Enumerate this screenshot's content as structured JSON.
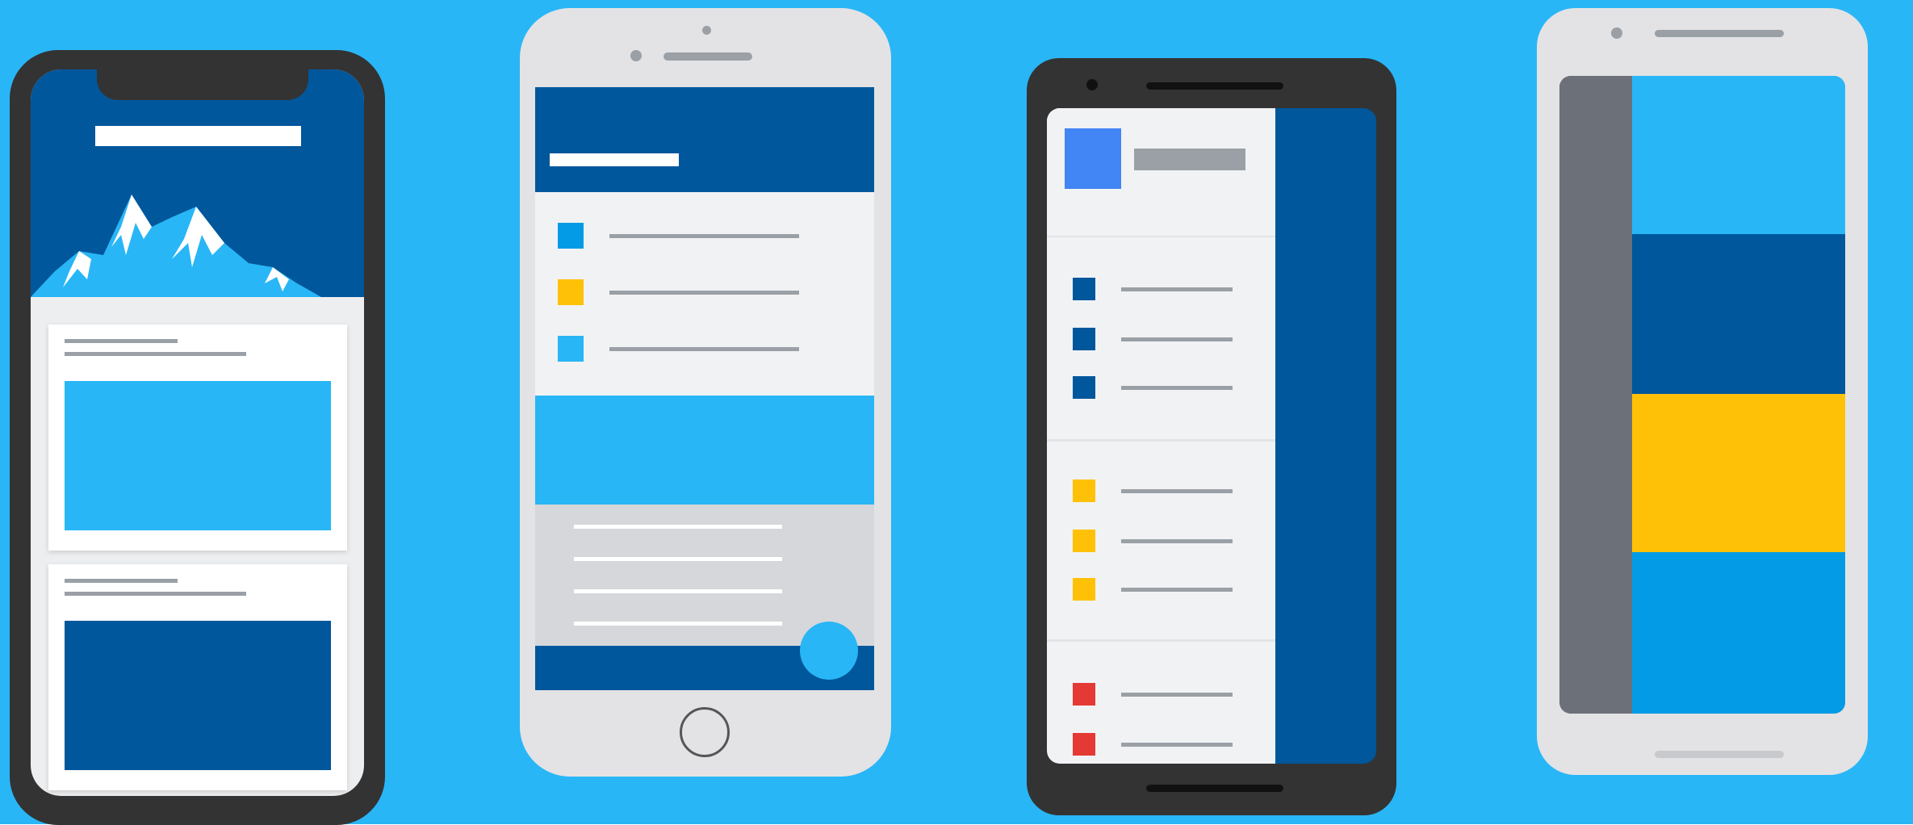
{
  "scene": {
    "background": "#29B6F6",
    "colors": {
      "dark_blue": "#01579B",
      "light_blue": "#29B6F6",
      "mid_blue": "#039BE5",
      "material_blue": "#4285F4",
      "yellow": "#FFC107",
      "red": "#E53935",
      "phone_dark": "#333333",
      "phone_light": "#E3E3E5",
      "gray_line": "#9AA0A6",
      "gray_panel": "#D5D7DB",
      "white": "#FFFFFF"
    }
  },
  "phones": [
    {
      "label": "phone-notch",
      "icons": [
        "mountain-icon"
      ]
    },
    {
      "label": "phone-home-button",
      "list_item_colors": [
        "#039BE5",
        "#FFC107",
        "#29B6F6"
      ],
      "icons": [
        "home-button-icon",
        "fab-circle-icon"
      ]
    },
    {
      "label": "phone-navigation-drawer",
      "group_colors": [
        "#01579B",
        "#FFC107",
        "#E53935"
      ],
      "icons": [
        "app-logo-icon"
      ]
    },
    {
      "label": "phone-color-stripes",
      "stripe_colors": [
        "#29B6F6",
        "#01579B",
        "#FFC107",
        "#039BE5"
      ]
    }
  ]
}
